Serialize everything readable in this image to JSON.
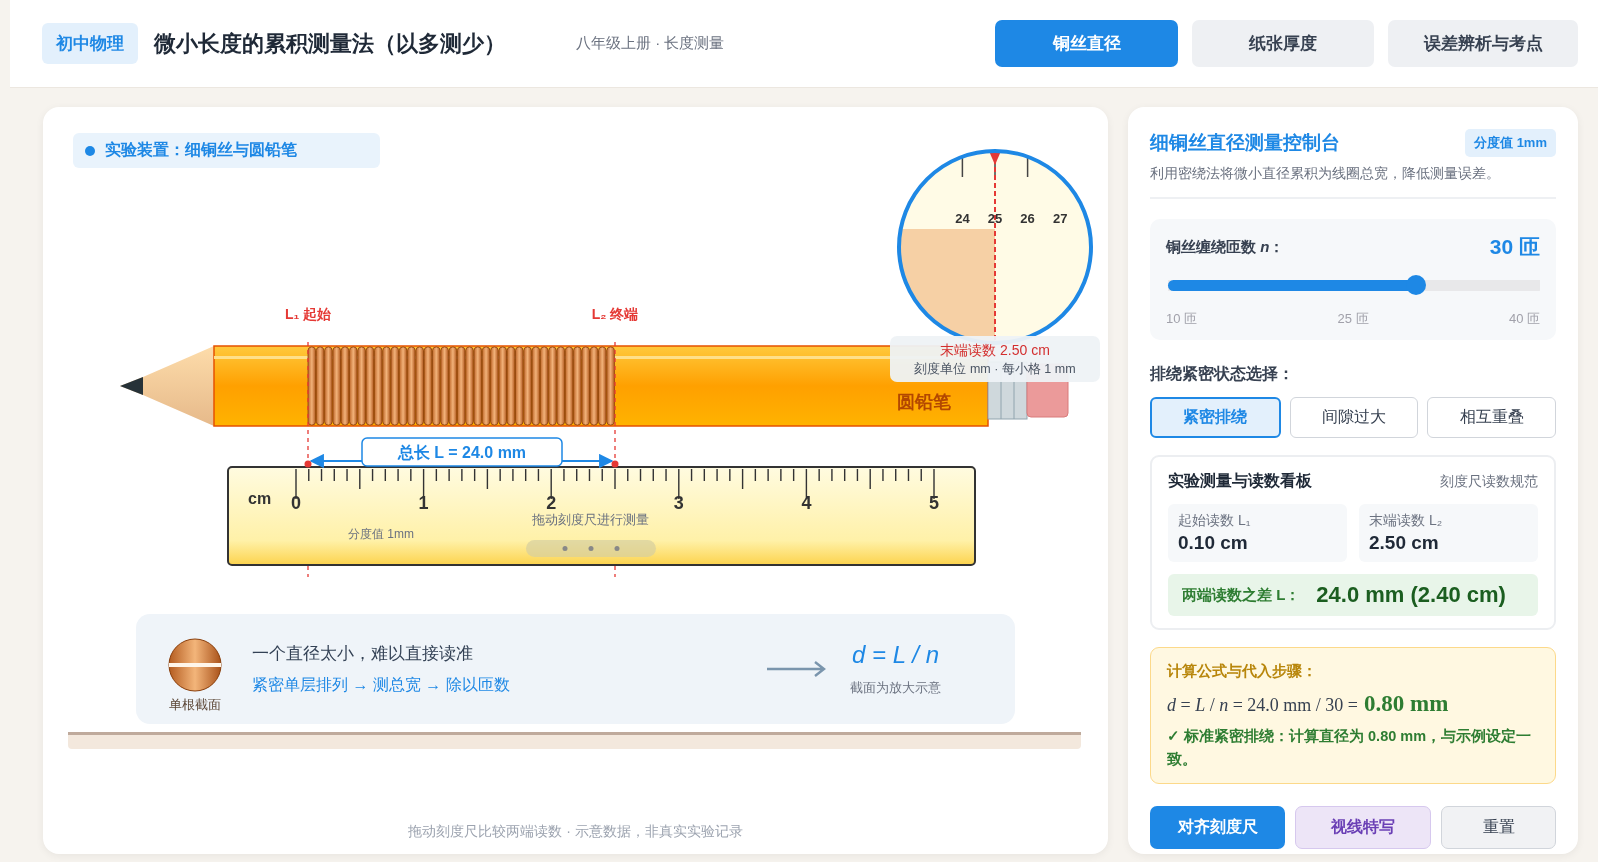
{
  "header": {
    "badge": "初中物理",
    "title": "微小长度的累积测量法（以多测少）",
    "subtitle": "八年级上册 · 长度测量"
  },
  "tabs": [
    {
      "label": "铜丝直径",
      "selected": true
    },
    {
      "label": "纸张厚度",
      "selected": false
    },
    {
      "label": "误差辨析与考点",
      "selected": false
    }
  ],
  "stage": {
    "device_label": "实验装置：细铜丝与圆铅笔",
    "pencil_label": "圆铅笔",
    "start_marker": "L₁ 起始",
    "end_marker": "L₂ 终端",
    "total_length": "总长 L = 24.0 mm",
    "ruler": {
      "unit": "cm",
      "numbers": [
        "0",
        "1",
        "2",
        "3",
        "4",
        "5"
      ],
      "scale_note": "分度值 1mm",
      "drag_hint": "拖动刻度尺进行测量"
    },
    "magnifier": {
      "numbers": [
        "24",
        "25",
        "26",
        "27"
      ],
      "reading": "末端读数 2.50 cm",
      "note": "刻度单位 mm · 每小格 1 mm"
    },
    "explanation": {
      "icon_caption": "单根截面",
      "line1": "一个直径太小，难以直接读准",
      "line2": "紧密单层排列 → 测总宽 → 除以匝数",
      "formula": "d = L / n",
      "formula_note": "截面为放大示意"
    },
    "footer": "拖动刻度尺比较两端读数 · 示意数据，非真实实验记录"
  },
  "panel": {
    "title": "细铜丝直径测量控制台",
    "scale_badge": "分度值 1mm",
    "description": "利用密绕法将微小直径累积为线圈总宽，降低测量误差。",
    "turns": {
      "label": "铜丝缠绕匝数 *n*：",
      "value": "30 匝",
      "level": 0.667,
      "ticks": [
        "10 匝",
        "25 匝",
        "40 匝"
      ]
    },
    "arrangement": {
      "label": "排绕紧密状态选择：",
      "options": [
        {
          "label": "紧密排绕",
          "selected": true
        },
        {
          "label": "间隙过大",
          "selected": false
        },
        {
          "label": "相互重叠",
          "selected": false
        }
      ]
    },
    "board": {
      "title": "实验测量与读数看板",
      "hint": "刻度尺读数规范",
      "readings": [
        {
          "label": "起始读数 L₁",
          "value": "0.10 cm"
        },
        {
          "label": "末端读数 L₂",
          "value": "2.50 cm"
        }
      ],
      "difference": {
        "label": "两端读数之差 L：",
        "value": "24.0 mm (2.40 cm)"
      }
    },
    "calculation": {
      "title": "计算公式与代入步骤：",
      "formula": "*d* = *L* / *n* = 24.0 mm / 30 =",
      "result": "0.80 mm",
      "check": "✓ 标准紧密排绕：计算直径为 0.80 mm，与示例设定一致。"
    },
    "buttons": [
      {
        "label": "对齐刻度尺",
        "kind": "primary"
      },
      {
        "label": "视线特写",
        "kind": "secondary"
      },
      {
        "label": "重置",
        "kind": "neutral"
      }
    ]
  }
}
